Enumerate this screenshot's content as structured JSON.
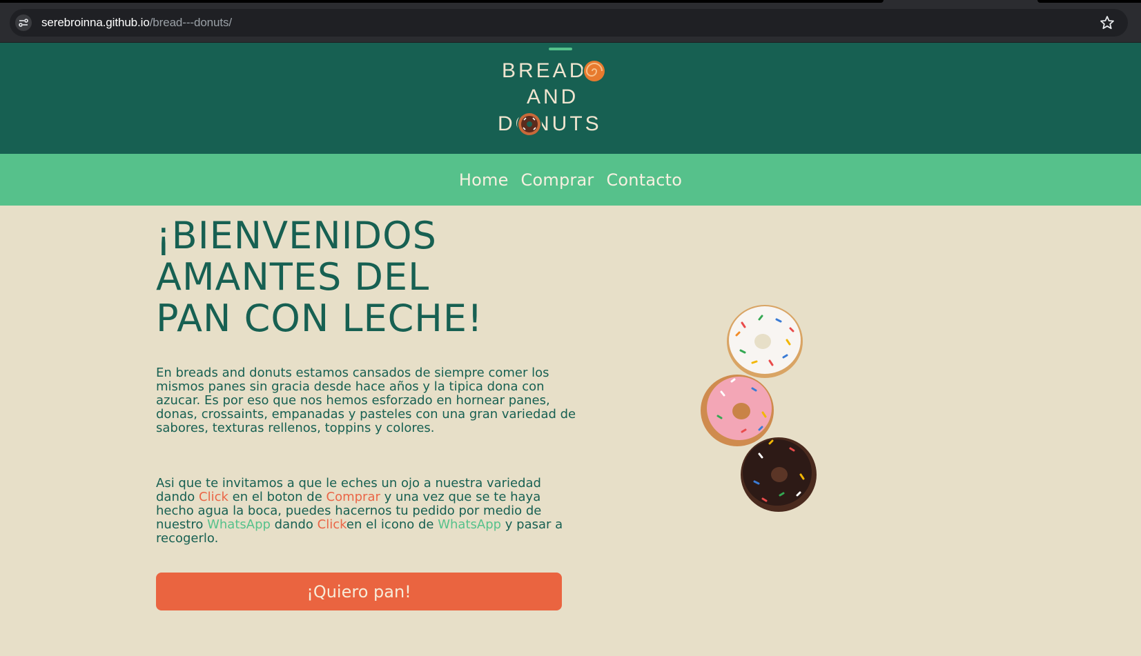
{
  "browser": {
    "url_host": "serebroinna.github.io",
    "url_path": "/bread---donuts/"
  },
  "header": {
    "logo_lines": [
      "BREADS",
      "AND",
      "DONUTS"
    ]
  },
  "nav": {
    "items": [
      {
        "label": "Home"
      },
      {
        "label": "Comprar"
      },
      {
        "label": "Contacto"
      }
    ]
  },
  "hero": {
    "title_lines": [
      "¡BIENVENIDOS",
      "AMANTES DEL",
      "PAN CON LECHE!"
    ],
    "paragraph1": "En breads and donuts estamos cansados de siempre comer los mismos panes sin gracia desde hace años y la tipica dona con azucar. Es por eso que nos hemos esforzado en hornear panes, donas, crossaints, empanadas y pasteles con una gran variedad de sabores, texturas rellenos, toppins y colores.",
    "paragraph2": {
      "t1": "Asi que te invitamos a que le eches un ojo a nuestra variedad dando ",
      "click1": "Click",
      "t2": " en el boton de ",
      "comprar": "Comprar",
      "t3": " y una vez que se te haya hecho agua la boca, puedes hacernos tu pedido por medio de nuestro ",
      "whatsapp1": "WhatsApp",
      "t4": " dando ",
      "click2": "Click",
      "t5": "en el icono de ",
      "whatsapp2": "WhatsApp",
      "t6": " y pasar a recogerlo."
    },
    "cta_label": "¡Quiero pan!"
  },
  "colors": {
    "header_bg": "#176052",
    "nav_bg": "#56c18b",
    "page_bg": "#e7dfc8",
    "accent_red": "#ea6546",
    "accent_green": "#56c18b"
  }
}
